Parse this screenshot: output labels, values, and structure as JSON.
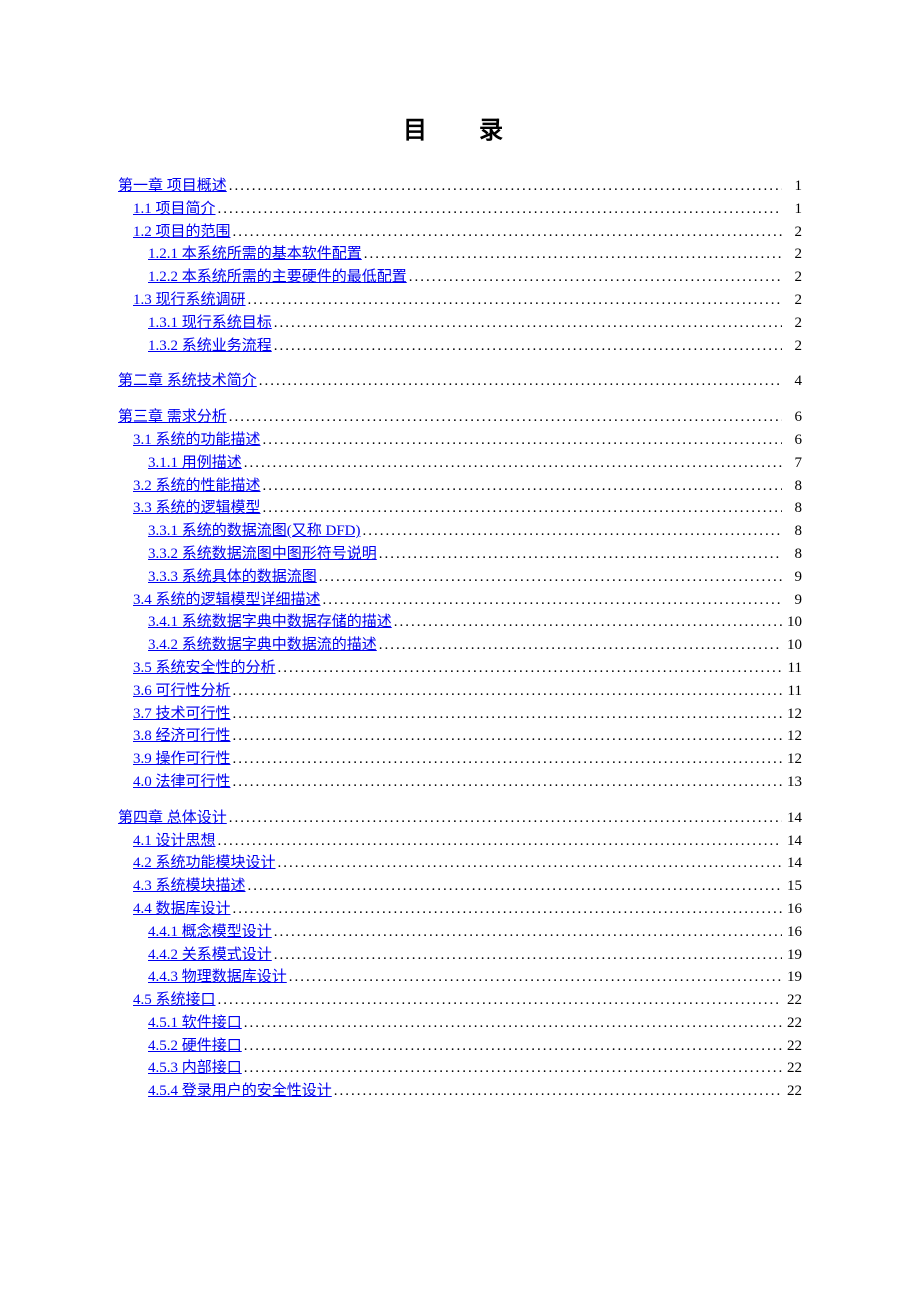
{
  "title": "目　录",
  "toc": [
    {
      "level": 1,
      "text": "第一章 项目概述",
      "page": "1"
    },
    {
      "level": 2,
      "text": "1.1 项目简介",
      "page": "1"
    },
    {
      "level": 2,
      "text": "1.2 项目的范围",
      "page": "2"
    },
    {
      "level": 3,
      "text": "1.2.1 本系统所需的基本软件配置",
      "page": "2"
    },
    {
      "level": 3,
      "text": "1.2.2 本系统所需的主要硬件的最低配置",
      "page": "2"
    },
    {
      "level": 2,
      "text": "1.3 现行系统调研",
      "page": "2"
    },
    {
      "level": 3,
      "text": "1.3.1 现行系统目标",
      "page": "2"
    },
    {
      "level": 3,
      "text": "1.3.2 系统业务流程",
      "page": "2"
    },
    {
      "level": 1,
      "text": "第二章 系统技术简介",
      "page": "4"
    },
    {
      "level": 1,
      "text": "第三章 需求分析",
      "page": "6"
    },
    {
      "level": 2,
      "text": "3.1 系统的功能描述",
      "page": "6"
    },
    {
      "level": 3,
      "text": "3.1.1 用例描述",
      "page": "7"
    },
    {
      "level": 2,
      "text": "3.2 系统的性能描述",
      "page": "8"
    },
    {
      "level": 2,
      "text": "3.3 系统的逻辑模型",
      "page": "8"
    },
    {
      "level": 3,
      "text": "3.3.1 系统的数据流图(又称 DFD)",
      "page": "8"
    },
    {
      "level": 3,
      "text": "3.3.2 系统数据流图中图形符号说明",
      "page": "8"
    },
    {
      "level": 3,
      "text": "3.3.3 系统具体的数据流图",
      "page": "9"
    },
    {
      "level": 2,
      "text": "3.4 系统的逻辑模型详细描述",
      "page": "9"
    },
    {
      "level": 3,
      "text": "3.4.1 系统数据字典中数据存储的描述",
      "page": "10"
    },
    {
      "level": 3,
      "text": "3.4.2 系统数据字典中数据流的描述",
      "page": "10"
    },
    {
      "level": 2,
      "text": "3.5 系统安全性的分析",
      "page": "11"
    },
    {
      "level": 2,
      "text": "3.6 可行性分析",
      "page": "11"
    },
    {
      "level": 2,
      "text": "3.7 技术可行性",
      "page": "12"
    },
    {
      "level": 2,
      "text": "3.8 经济可行性",
      "page": "12"
    },
    {
      "level": 2,
      "text": "3.9 操作可行性",
      "page": "12"
    },
    {
      "level": 2,
      "text": "4.0 法律可行性",
      "page": "13"
    },
    {
      "level": 1,
      "text": "第四章 总体设计",
      "page": "14"
    },
    {
      "level": 2,
      "text": "4.1 设计思想",
      "page": "14"
    },
    {
      "level": 2,
      "text": "4.2 系统功能模块设计",
      "page": "14"
    },
    {
      "level": 2,
      "text": "4.3 系统模块描述",
      "page": "15"
    },
    {
      "level": 2,
      "text": "4.4 数据库设计",
      "page": "16"
    },
    {
      "level": 3,
      "text": "4.4.1 概念模型设计",
      "page": "16"
    },
    {
      "level": 3,
      "text": "4.4.2 关系模式设计",
      "page": "19"
    },
    {
      "level": 3,
      "text": "4.4.3 物理数据库设计",
      "page": "19"
    },
    {
      "level": 2,
      "text": "4.5 系统接口",
      "page": "22"
    },
    {
      "level": 3,
      "text": "4.5.1 软件接口",
      "page": "22"
    },
    {
      "level": 3,
      "text": "4.5.2 硬件接口",
      "page": "22"
    },
    {
      "level": 3,
      "text": "4.5.3 内部接口",
      "page": "22"
    },
    {
      "level": 3,
      "text": "4.5.4 登录用户的安全性设计",
      "page": "22"
    }
  ]
}
